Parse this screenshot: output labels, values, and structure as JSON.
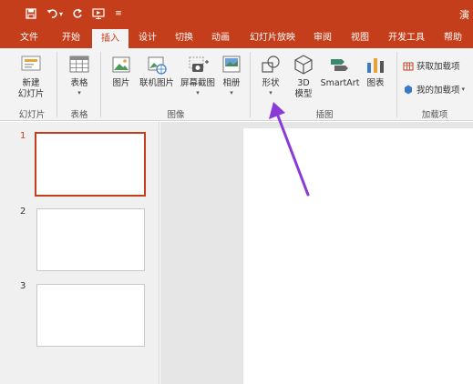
{
  "title_bar": {
    "quick_access": [
      {
        "icon": "save-icon"
      },
      {
        "icon": "undo-icon"
      },
      {
        "icon": "redo-icon"
      },
      {
        "icon": "start-from-beginning-icon"
      },
      {
        "icon": "customize-quick-access-icon"
      }
    ],
    "title_fragment": "演"
  },
  "tabs": [
    {
      "label": "文件"
    },
    {
      "label": "开始"
    },
    {
      "label": "插入",
      "active": true
    },
    {
      "label": "设计"
    },
    {
      "label": "切换"
    },
    {
      "label": "动画"
    },
    {
      "label": "幻灯片放映"
    },
    {
      "label": "审阅"
    },
    {
      "label": "视图"
    },
    {
      "label": "开发工具"
    },
    {
      "label": "帮助"
    }
  ],
  "ribbon": {
    "groups": {
      "slides": {
        "label": "幻灯片",
        "new_slide": {
          "line1": "新建",
          "line2": "幻灯片",
          "icon": "new-slide-icon"
        }
      },
      "tables": {
        "label": "表格",
        "table": {
          "label": "表格",
          "icon": "table-icon"
        }
      },
      "images": {
        "label": "图像",
        "picture": {
          "label": "图片",
          "icon": "picture-icon"
        },
        "online_picture": {
          "label": "联机图片",
          "icon": "online-picture-icon"
        },
        "screenshot": {
          "label": "屏幕截图",
          "icon": "screenshot-icon"
        },
        "album": {
          "label": "相册",
          "icon": "photo-album-icon"
        }
      },
      "illustrations": {
        "label": "插图",
        "shapes": {
          "label": "形状",
          "icon": "shapes-icon"
        },
        "model3d": {
          "line1": "3D",
          "line2": "模型",
          "icon": "3d-model-icon"
        },
        "smartart": {
          "label": "SmartArt",
          "icon": "smartart-icon"
        },
        "chart": {
          "label": "图表",
          "icon": "chart-icon"
        }
      },
      "addins": {
        "label": "加载项",
        "get_addins": {
          "label": "获取加载项",
          "icon": "store-icon"
        },
        "my_addins": {
          "label": "我的加载项",
          "icon": "my-addins-icon"
        }
      }
    }
  },
  "slides_pane": {
    "slides": [
      {
        "number": "1",
        "selected": true
      },
      {
        "number": "2",
        "selected": false
      },
      {
        "number": "3",
        "selected": false
      }
    ]
  },
  "annotation": {
    "color": "#8a3bd6",
    "icon": "purple-arrow-pointing-to-shapes"
  },
  "colors": {
    "accent": "#c43e1c",
    "ribbon_bg": "#f3f3f3"
  }
}
